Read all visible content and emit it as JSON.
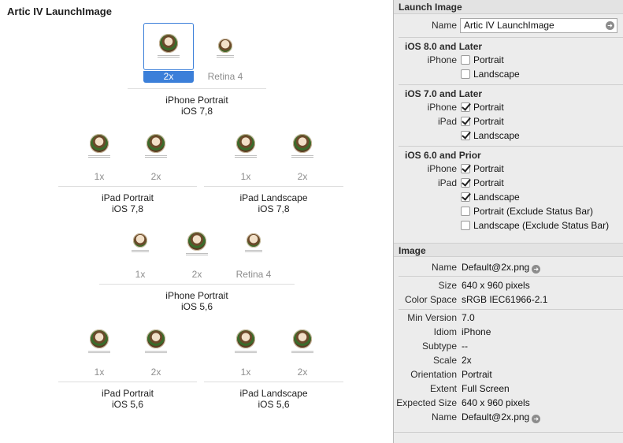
{
  "catalog": {
    "title": "Artic IV LaunchImage",
    "groups": [
      {
        "title": "iPhone Portrait",
        "subtitle": "iOS 7,8",
        "slots": [
          "2x",
          "Retina 4"
        ],
        "selected": "2x"
      },
      {
        "title": "iPad Portrait",
        "subtitle": "iOS 7,8",
        "slots": [
          "1x",
          "2x"
        ]
      },
      {
        "title": "iPad Landscape",
        "subtitle": "iOS 7,8",
        "slots": [
          "1x",
          "2x"
        ]
      },
      {
        "title": "iPhone Portrait",
        "subtitle": "iOS 5,6",
        "slots": [
          "1x",
          "2x",
          "Retina 4"
        ]
      },
      {
        "title": "iPad Portrait",
        "subtitle": "iOS 5,6",
        "slots": [
          "1x",
          "2x"
        ]
      },
      {
        "title": "iPad Landscape",
        "subtitle": "iOS 5,6",
        "slots": [
          "1x",
          "2x"
        ]
      }
    ]
  },
  "inspector": {
    "launch_image": {
      "header": "Launch Image",
      "name_label": "Name",
      "name_value": "Artic IV LaunchImage",
      "ios8": {
        "title": "iOS 8.0 and Later",
        "iphone_label": "iPhone",
        "portrait": {
          "label": "Portrait",
          "checked": false
        },
        "landscape": {
          "label": "Landscape",
          "checked": false
        }
      },
      "ios7": {
        "title": "iOS 7.0 and Later",
        "iphone_label": "iPhone",
        "ipad_label": "iPad",
        "iphone_portrait": {
          "label": "Portrait",
          "checked": true
        },
        "ipad_portrait": {
          "label": "Portrait",
          "checked": true
        },
        "ipad_landscape": {
          "label": "Landscape",
          "checked": true
        }
      },
      "ios6": {
        "title": "iOS 6.0 and Prior",
        "iphone_label": "iPhone",
        "ipad_label": "iPad",
        "iphone_portrait": {
          "label": "Portrait",
          "checked": true
        },
        "ipad_portrait": {
          "label": "Portrait",
          "checked": true
        },
        "ipad_landscape": {
          "label": "Landscape",
          "checked": true
        },
        "portrait_exclude": {
          "label": "Portrait (Exclude Status Bar)",
          "checked": false
        },
        "landscape_exclude": {
          "label": "Landscape (Exclude Status Bar)",
          "checked": false
        }
      }
    },
    "image": {
      "header": "Image",
      "name": {
        "label": "Name",
        "value": "Default@2x.png"
      },
      "size": {
        "label": "Size",
        "value": "640 x 960 pixels"
      },
      "color_space": {
        "label": "Color Space",
        "value": "sRGB IEC61966-2.1"
      },
      "min_version": {
        "label": "Min Version",
        "value": "7.0"
      },
      "idiom": {
        "label": "Idiom",
        "value": "iPhone"
      },
      "subtype": {
        "label": "Subtype",
        "value": "--"
      },
      "scale": {
        "label": "Scale",
        "value": "2x"
      },
      "orientation": {
        "label": "Orientation",
        "value": "Portrait"
      },
      "extent": {
        "label": "Extent",
        "value": "Full Screen"
      },
      "expected_size": {
        "label": "Expected Size",
        "value": "640 x 960 pixels"
      },
      "file_name": {
        "label": "Name",
        "value": "Default@2x.png"
      }
    }
  },
  "colors": {
    "selection": "#3b7fd9",
    "inspector_bg": "#ececec"
  },
  "icons": {
    "go": "arrow-circle-right-icon"
  }
}
